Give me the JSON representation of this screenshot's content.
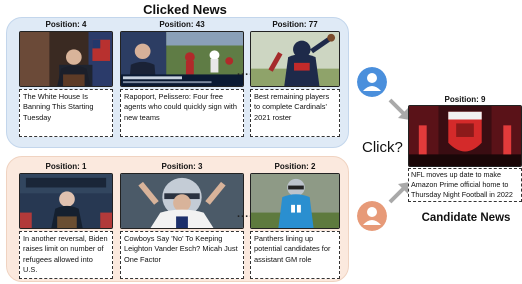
{
  "clicked_title": "Clicked News",
  "candidate_title": "Candidate News",
  "click_label": "Click?",
  "dots": "......",
  "user1_news": [
    {
      "position": "Position: 4",
      "caption": "The White House Is Banning This Starting Tuesday"
    },
    {
      "position": "Position: 43",
      "caption": "Rapoport, Pelissero: Four free agents who could quickly sign with new teams"
    },
    {
      "position": "Position: 77",
      "caption": "Best remaining players to complete Cardinals' 2021 roster"
    }
  ],
  "user2_news": [
    {
      "position": "Position: 1",
      "caption": "In another reversal, Biden raises limit on number of refugees allowed into U.S."
    },
    {
      "position": "Position: 3",
      "caption": "Cowboys Say 'No' To Keeping Leighton Vander Esch? Micah Just One Factor"
    },
    {
      "position": "Position: 2",
      "caption": "Panthers lining up potential candidates for assistant GM role"
    }
  ],
  "candidate": {
    "position": "Position: 9",
    "caption": "NFL moves up date to make Amazon Prime official home to Thursday Night Football in 2022"
  },
  "colors": {
    "panel_blue": "#dfeaf6",
    "panel_orange": "#fbe9de",
    "user_blue": "#4a8fdc",
    "user_orange": "#e79a78",
    "arrow_gray": "#a9a9a9"
  }
}
